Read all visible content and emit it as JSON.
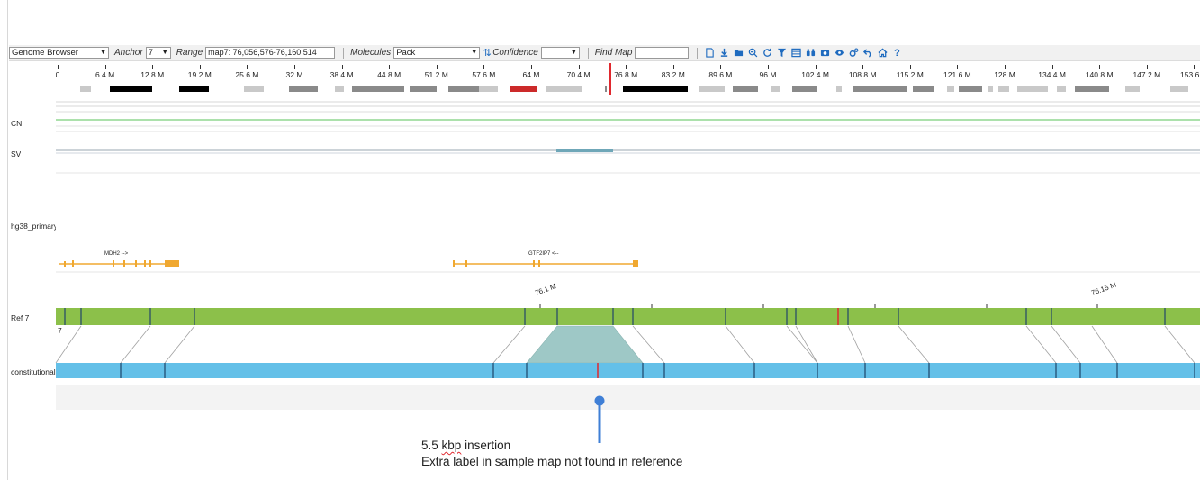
{
  "toolbar": {
    "view_select": "Genome Browser",
    "anchor_label": "Anchor",
    "anchor_value": "7",
    "range_label": "Range",
    "range_value": "map7: 76,056,576-76,160,514",
    "molecules_label": "Molecules",
    "molecules_value": "Pack",
    "confidence_label": "Confidence",
    "confidence_value": "",
    "find_map_label": "Find Map",
    "find_map_value": "",
    "icons": [
      "pdf-icon",
      "download-icon",
      "folder-open-icon",
      "zoom-out-icon",
      "refresh-icon",
      "filter-icon",
      "table-icon",
      "binoculars-icon",
      "camera-icon",
      "eye-icon",
      "settings-icon",
      "undo-icon",
      "home-icon",
      "help-icon"
    ]
  },
  "ruler": {
    "ticks": [
      "0",
      "6.4 M",
      "12.8 M",
      "19.2 M",
      "25.6 M",
      "32 M",
      "38.4 M",
      "44.8 M",
      "51.2 M",
      "57.6 M",
      "64 M",
      "70.4 M",
      "76.8 M",
      "83.2 M",
      "89.6 M",
      "96 M",
      "102.4 M",
      "108.8 M",
      "115.2 M",
      "121.6 M",
      "128 M",
      "134.4 M",
      "140.8 M",
      "147.2 M",
      "153.6 M"
    ]
  },
  "tracks": {
    "cn_label": "CN",
    "sv_label": "SV",
    "annotation_label": "hg38_primary",
    "ref_label": "Ref 7",
    "ref_sublabel": "7",
    "sample_label": "constitutional"
  },
  "genes": {
    "gene1": "MDH2 -->",
    "gene2": "GTF2IP7 <--"
  },
  "ref_ticks": {
    "tick1": "76.1 M",
    "tick2": "76.15 M"
  },
  "callout": {
    "title_size": "5.5",
    "title_unit": "kbp",
    "title_rest": "insertion",
    "subtitle": "Extra label in sample map not found in reference"
  },
  "colors": {
    "ref_map": "#8cc04a",
    "sample_map": "#64c0e8",
    "insertion": "#9ec8c6",
    "gene": "#f0a830",
    "marker": "#e0282e",
    "callout": "#3f7fd6"
  }
}
